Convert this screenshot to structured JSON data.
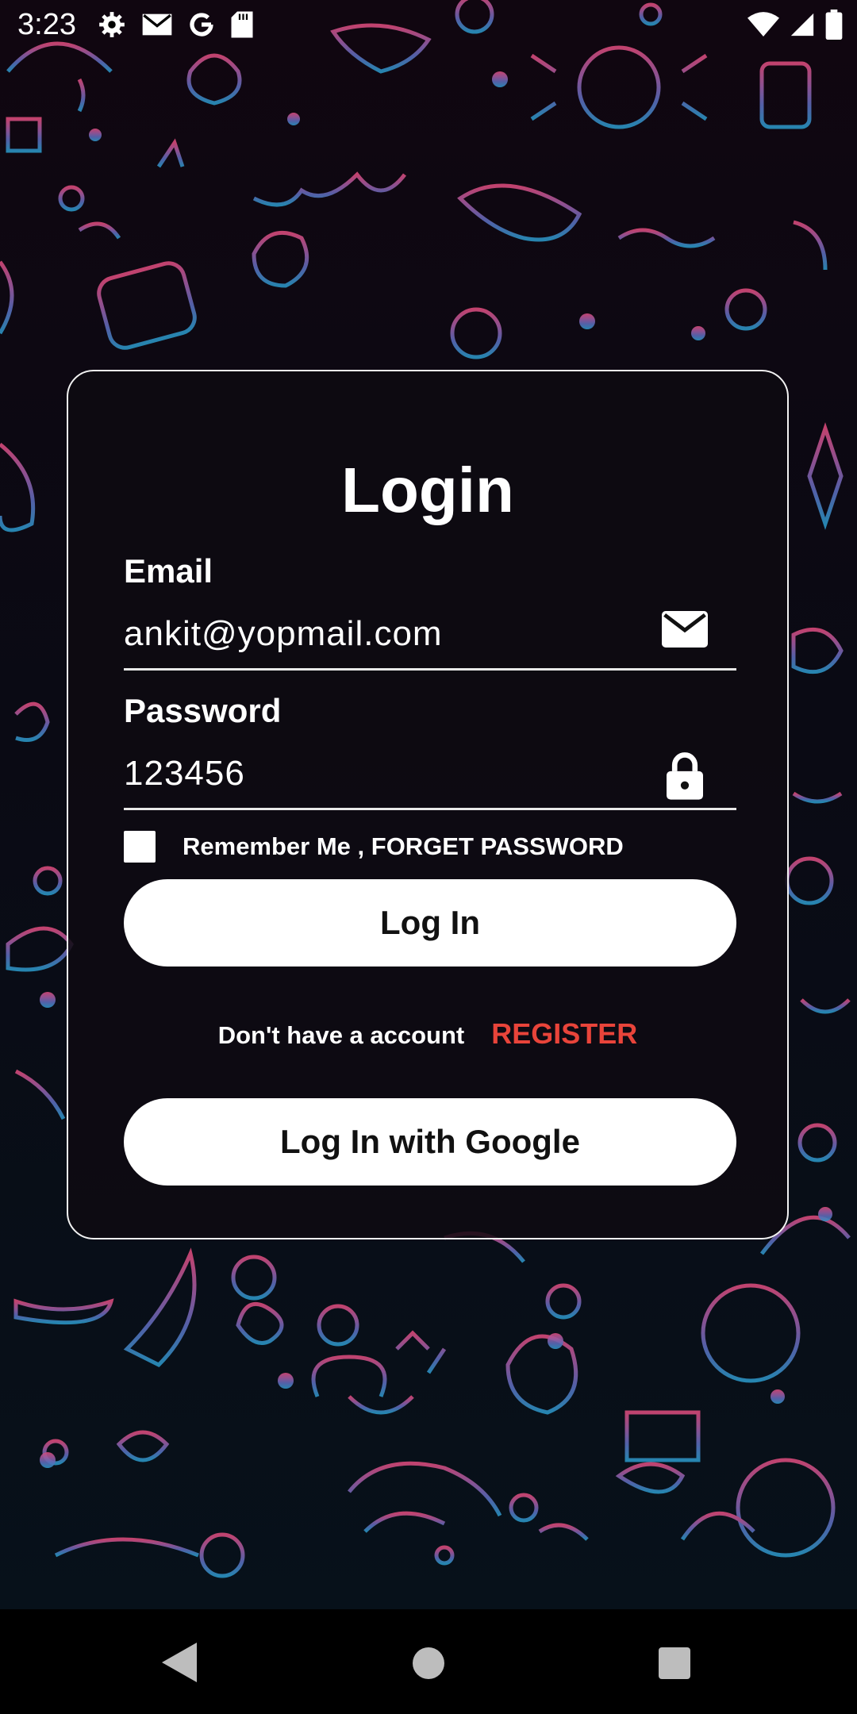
{
  "status_bar": {
    "time": "3:23",
    "icons": [
      "gear-icon",
      "gmail-icon",
      "google-icon",
      "sd-card-icon",
      "wifi-icon",
      "signal-icon",
      "battery-icon"
    ]
  },
  "login": {
    "title": "Login",
    "email_label": "Email",
    "email_value": "ankit@yopmail.com",
    "password_label": "Password",
    "password_value": "123456",
    "remember_text": "Remember Me , FORGET PASSWORD",
    "login_button": "Log In",
    "no_account_text": "Don't have a account",
    "register_link": "REGISTER",
    "google_button": "Log In with Google"
  },
  "colors": {
    "register": "#e8443a",
    "card_border": "#f2f2f2",
    "background_top": "#d04a78",
    "background_bottom": "#2a8fc0"
  },
  "nav_bar": {
    "icons": [
      "back-icon",
      "home-icon",
      "recents-icon"
    ]
  }
}
